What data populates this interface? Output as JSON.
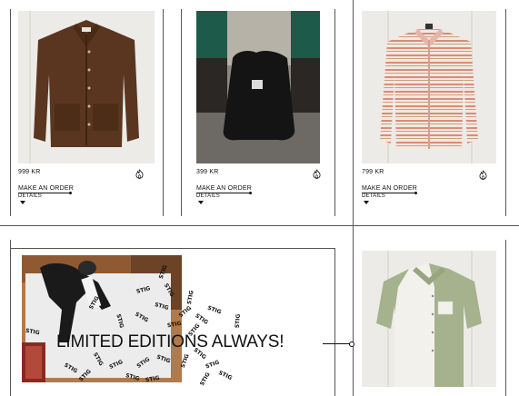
{
  "products": [
    {
      "price": "999 KR",
      "order_label": "MAKE AN ORDER",
      "details_label": "DETAILS",
      "image": "brown-chore-jacket",
      "favorite_icon": "flame-icon"
    },
    {
      "price": "399 KR",
      "order_label": "MAKE AN ORDER",
      "details_label": "DETAILS",
      "image": "black-tote-bag",
      "favorite_icon": "flame-icon"
    },
    {
      "price": "799 KR",
      "order_label": "MAKE AN ORDER",
      "details_label": "DETAILS",
      "image": "striped-shirt",
      "favorite_icon": "flame-icon"
    }
  ],
  "banner": {
    "headline": "LIMITED EDITIONS ALWAYS!",
    "stamp_text": "STIG",
    "image": "person-stamping-paper"
  },
  "next_product": {
    "image": "short-sleeve-shirt"
  },
  "colors": {
    "line": "#555555",
    "text": "#111111",
    "background": "#ffffff"
  }
}
